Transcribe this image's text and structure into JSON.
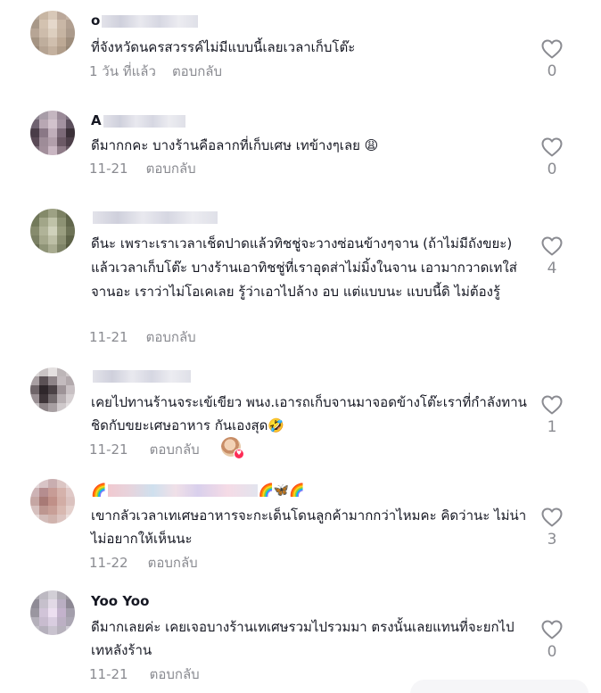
{
  "comments": [
    {
      "name": "o",
      "text": "ที่จังหวัดนครสวรรค์ไม่มีแบบนี้เลยเวลาเก็บโต๊ะ",
      "time": "1 วัน ที่แล้ว",
      "reply": "ตอบกลับ",
      "likes": "0",
      "avatar": [
        "#b4a597",
        "#c8b6a3",
        "#d8c8b8",
        "#bba89a",
        "#c4b3a5",
        "#a89888",
        "#d3c2b0",
        "#e5d8cb",
        "#c9b7a6",
        "#b19f90",
        "#b7a595",
        "#cdbcab",
        "#ddcfbf",
        "#c6b4a2",
        "#ab9a8b",
        "#a59483",
        "#bfae9d",
        "#d0bfae",
        "#bda995",
        "#9e8d7c",
        "#9a8979",
        "#b5a392",
        "#c4b19f",
        "#b09d8a",
        "#968674"
      ]
    },
    {
      "name": "A",
      "text": "ดีมากกคะ บางร้านคือลากที่เก็บเศษ เทข้างๆเลย 😩",
      "time": "11-21",
      "reply": "ตอบกลับ",
      "likes": "0",
      "avatar": [
        "#8e8590",
        "#a89da8",
        "#c4b6c0",
        "#9a8a98",
        "#7b6f7e",
        "#6f6270",
        "#b8a7b3",
        "#d2c2cc",
        "#a392a0",
        "#5c4f5c",
        "#4a3d48",
        "#8a7886",
        "#c0aeba",
        "#7c6a78",
        "#3b3038",
        "#5a4a56",
        "#9e8c98",
        "#b29fab",
        "#6c5a66",
        "#4d3f49",
        "#7a6a76",
        "#a28f9b",
        "#c9b6c2",
        "#8f7c88",
        "#655560"
      ]
    },
    {
      "name": "",
      "text": "ดีนะ เพราะเราเวลาเช็ดปาดแล้วทิชชู่จะวางซ่อนข้างๆจาน (ถ้าไม่มีถังขยะ) แล้วเวลาเก็บโต๊ะ บางร้านเอาทิชชู่ที่เราอุดส่าไม่มิ้งในจาน เอามากวาดเทใส่จานอะ เราว่าไม่โอเคเลย รู้ว่าเอาไปล้าง อบ แต่แบบนะ แบบนี้ดิ ไม่ต้องรู้",
      "time": "11-21",
      "reply": "ตอบกลับ",
      "likes": "4",
      "avatar": [
        "#6f7558",
        "#848a6a",
        "#9da184",
        "#7c8163",
        "#5f6449",
        "#737a5b",
        "#a2a689",
        "#bfc2a8",
        "#8d9274",
        "#62674c",
        "#868b6d",
        "#b0b398",
        "#cfd1bb",
        "#9a9e80",
        "#6d7256",
        "#7b8064",
        "#a5a88c",
        "#bdbfa6",
        "#8c9073",
        "#5e6348",
        "#686d52",
        "#8f9477",
        "#a8ab90",
        "#7e8367",
        "#55593f"
      ]
    },
    {
      "name": "",
      "text": "เคยไปทานร้านจระเข้เขียว พนง.เอารถเก็บจานมาจอดข้างโต๊ะเราที่กำลังทานชิดกับขยะเศษอาหาร กันเองสุด🤣",
      "time": "11-21",
      "reply": "ตอบกลับ",
      "likes": "1",
      "avatar": [
        "#d8d4d4",
        "#c9c3c4",
        "#e4e0e0",
        "#bdb6b8",
        "#cfc9ca",
        "#a89fa2",
        "#5b5155",
        "#8e8488",
        "#c3bbbe",
        "#b2a9ac",
        "#6f6569",
        "#2f272b",
        "#4b4246",
        "#9d9397",
        "#c8c0c3",
        "#9a9094",
        "#3e3539",
        "#726a6d",
        "#b7afb2",
        "#d6d0d2",
        "#c5bfc1",
        "#8d8487",
        "#a79fa2",
        "#cfc9cb",
        "#e2dedf"
      ]
    },
    {
      "name": "🌈",
      "name_tail": "🌈🦋🌈",
      "text": "เขากลัวเวลาเทเศษอาหารจะกะเด็นโดนลูกค้ามากกว่าไหมคะ คิดว่านะ ไม่น่าไม่อยากให้เห็นนะ",
      "time": "11-22",
      "reply": "ตอบกลับ",
      "likes": "3",
      "avatar": [
        "#e4d6d8",
        "#d8c4c6",
        "#c9aeb0",
        "#dcc6c4",
        "#eadcdc",
        "#cdb3b5",
        "#b58d8f",
        "#c79c96",
        "#d5b2ab",
        "#e0c9c7",
        "#c5a6a3",
        "#a87a76",
        "#c09088",
        "#d2ada5",
        "#dbc2bf",
        "#d6c0be",
        "#bd9690",
        "#c89f97",
        "#d8b8b0",
        "#e4d0cc",
        "#e6d8d6",
        "#d3bcb9",
        "#d0b3ad",
        "#dcc4c0",
        "#ece0de"
      ]
    },
    {
      "name": "Yoo Yoo",
      "text": "ดีมากเลยค่ะ เคยเจอบางร้านเทเศษรวมไปรวมมา ตรงนั้นเลยแทนที่จะยกไปเทหลังร้าน",
      "time": "11-21",
      "reply": "ตอบกลับ",
      "likes": "0",
      "avatar": [
        "#a7a4ac",
        "#bdb9c2",
        "#d2cfd6",
        "#b0acb5",
        "#9b97a0",
        "#8f8b96",
        "#c6c0cc",
        "#e2d9e6",
        "#b9aec2",
        "#8d8894",
        "#9a96a0",
        "#d1c4d8",
        "#ecdff0",
        "#c3b2cc",
        "#a39eab",
        "#b4b0ba",
        "#c8bccf",
        "#d9cde0",
        "#bcb0c4",
        "#aba6b3",
        "#c2bfc7",
        "#b5b0bc",
        "#c9c3cf",
        "#b7b2bd",
        "#d0ccd5"
      ]
    }
  ],
  "colors": {
    "meta": "#8a8b91",
    "text": "#161823",
    "heart_outline": "#8a8b91"
  },
  "icons": {
    "like": "heart-outline-icon",
    "creator_like": "creator-liked-icon"
  }
}
